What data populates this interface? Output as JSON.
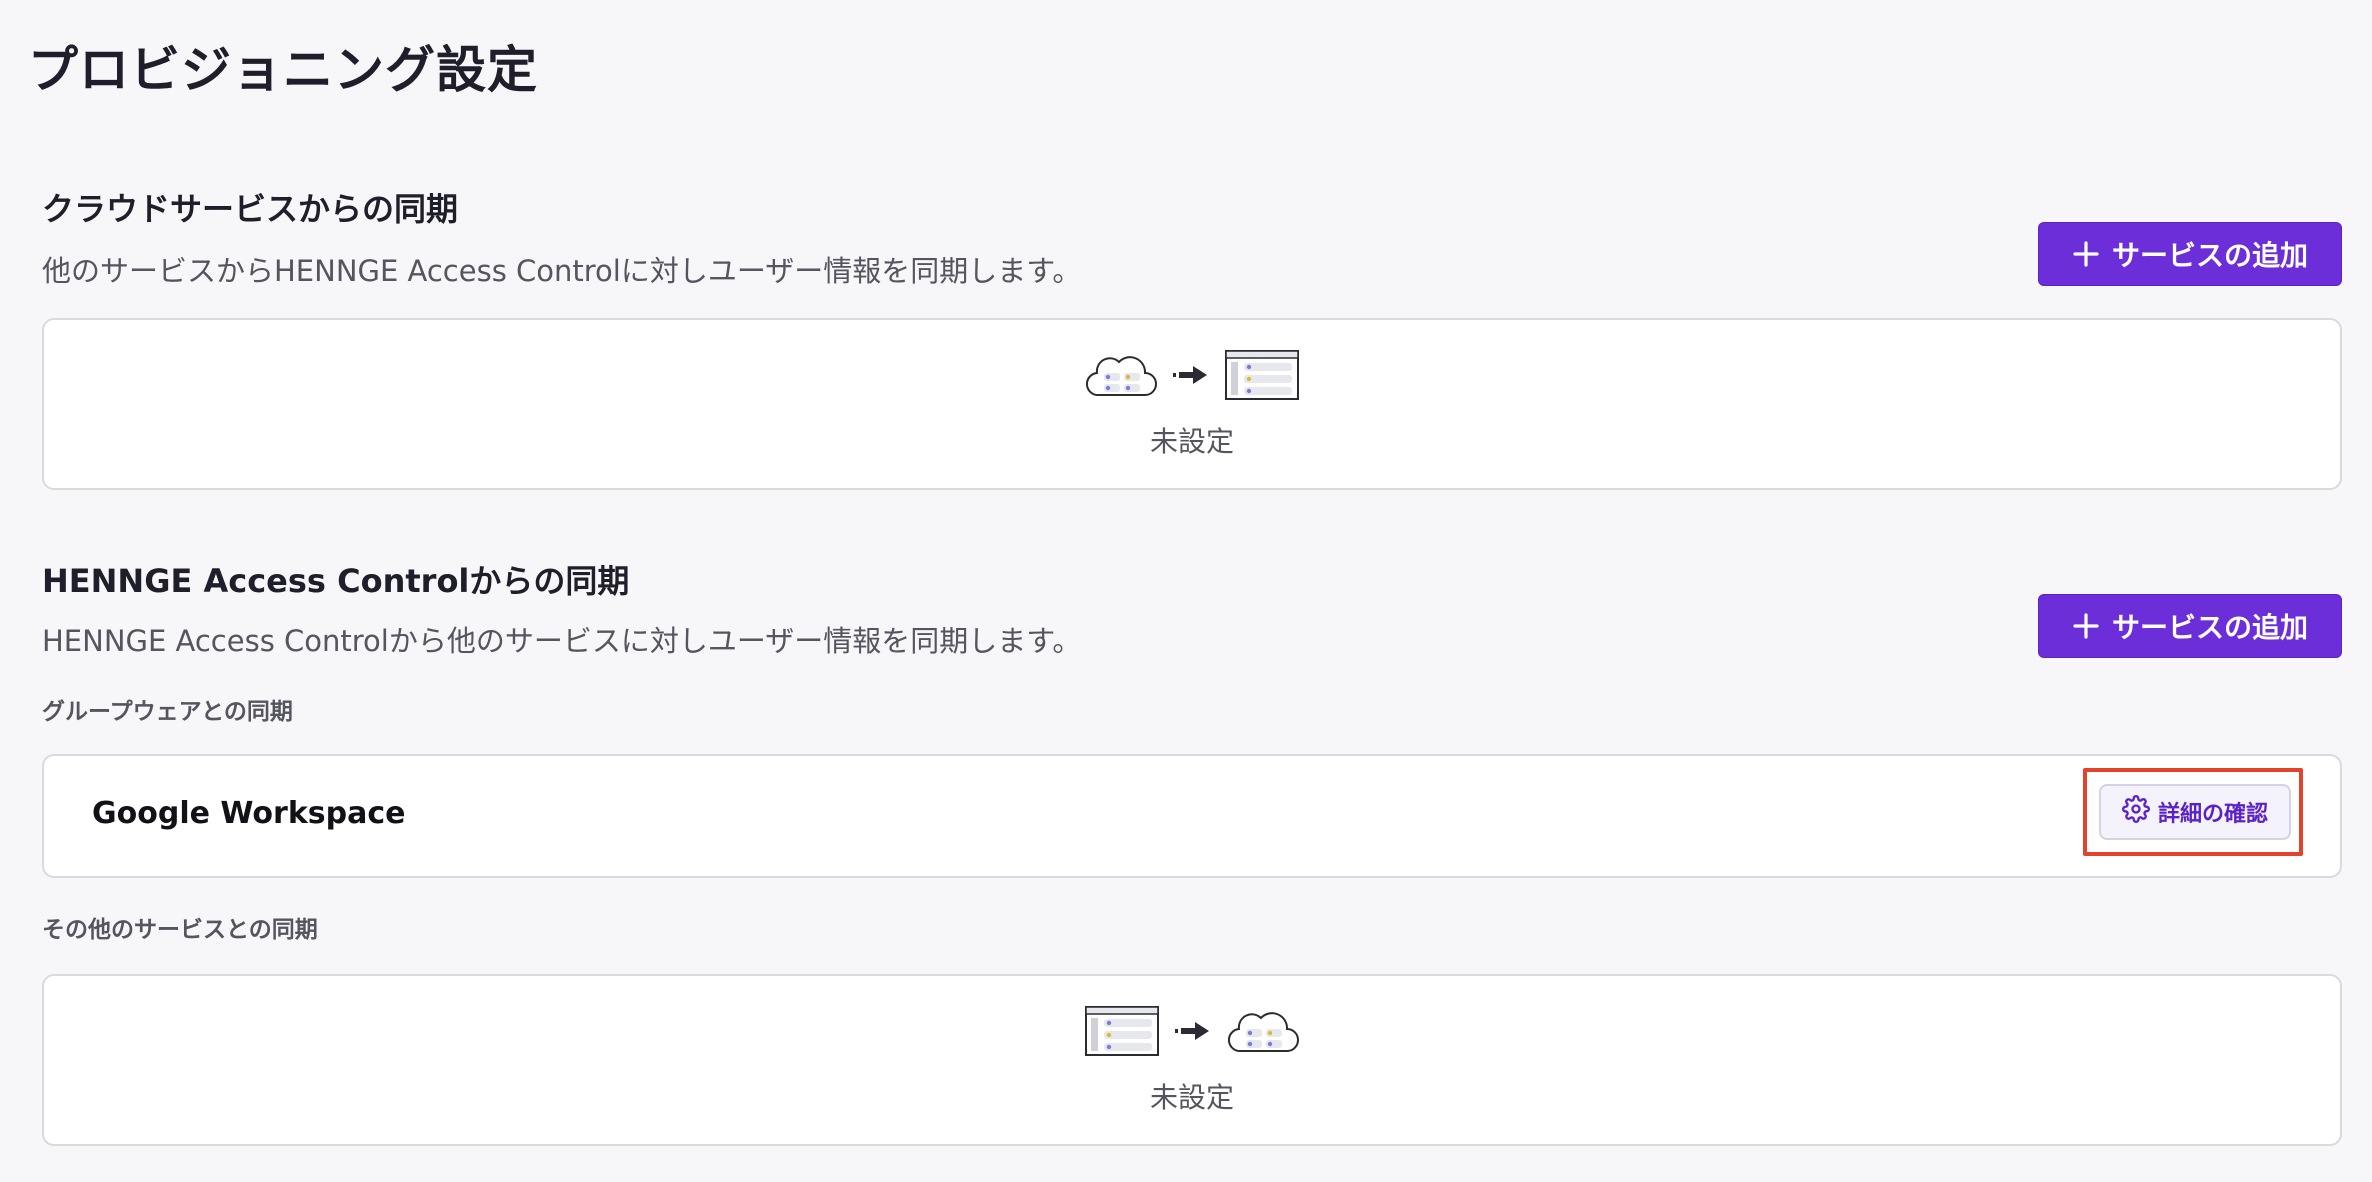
{
  "page": {
    "title": "プロビジョニング設定"
  },
  "cloud_sync": {
    "title": "クラウドサービスからの同期",
    "description": "他のサービスからHENNGE Access Controlに対しユーザー情報を同期します。",
    "add_button_label": "サービスの追加",
    "empty_text": "未設定"
  },
  "henngeac_sync": {
    "title": "HENNGE Access Controlからの同期",
    "description": "HENNGE Access Controlから他のサービスに対しユーザー情報を同期します。",
    "add_button_label": "サービスの追加",
    "groupware": {
      "label": "グループウェアとの同期",
      "service_name": "Google Workspace",
      "detail_button_label": "詳細の確認"
    },
    "other": {
      "label": "その他のサービスとの同期",
      "empty_text": "未設定"
    }
  },
  "colors": {
    "accent": "#6c2ed8",
    "highlight": "#e4432b",
    "background": "#f7f7f9"
  }
}
